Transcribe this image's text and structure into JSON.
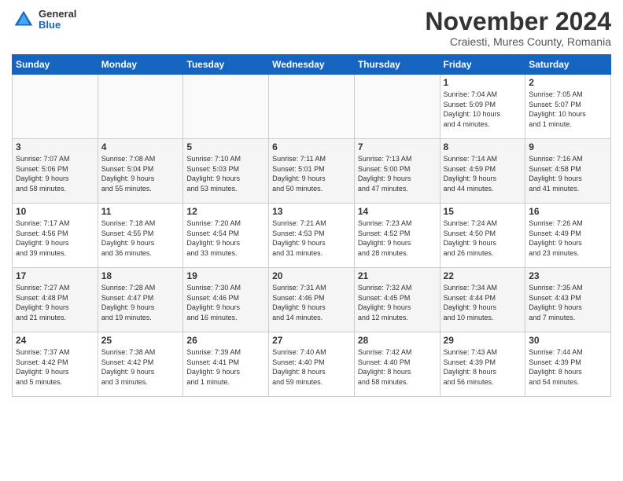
{
  "header": {
    "logo_general": "General",
    "logo_blue": "Blue",
    "month_title": "November 2024",
    "subtitle": "Craiesti, Mures County, Romania"
  },
  "weekdays": [
    "Sunday",
    "Monday",
    "Tuesday",
    "Wednesday",
    "Thursday",
    "Friday",
    "Saturday"
  ],
  "weeks": [
    [
      {
        "day": "",
        "info": ""
      },
      {
        "day": "",
        "info": ""
      },
      {
        "day": "",
        "info": ""
      },
      {
        "day": "",
        "info": ""
      },
      {
        "day": "",
        "info": ""
      },
      {
        "day": "1",
        "info": "Sunrise: 7:04 AM\nSunset: 5:09 PM\nDaylight: 10 hours\nand 4 minutes."
      },
      {
        "day": "2",
        "info": "Sunrise: 7:05 AM\nSunset: 5:07 PM\nDaylight: 10 hours\nand 1 minute."
      }
    ],
    [
      {
        "day": "3",
        "info": "Sunrise: 7:07 AM\nSunset: 5:06 PM\nDaylight: 9 hours\nand 58 minutes."
      },
      {
        "day": "4",
        "info": "Sunrise: 7:08 AM\nSunset: 5:04 PM\nDaylight: 9 hours\nand 55 minutes."
      },
      {
        "day": "5",
        "info": "Sunrise: 7:10 AM\nSunset: 5:03 PM\nDaylight: 9 hours\nand 53 minutes."
      },
      {
        "day": "6",
        "info": "Sunrise: 7:11 AM\nSunset: 5:01 PM\nDaylight: 9 hours\nand 50 minutes."
      },
      {
        "day": "7",
        "info": "Sunrise: 7:13 AM\nSunset: 5:00 PM\nDaylight: 9 hours\nand 47 minutes."
      },
      {
        "day": "8",
        "info": "Sunrise: 7:14 AM\nSunset: 4:59 PM\nDaylight: 9 hours\nand 44 minutes."
      },
      {
        "day": "9",
        "info": "Sunrise: 7:16 AM\nSunset: 4:58 PM\nDaylight: 9 hours\nand 41 minutes."
      }
    ],
    [
      {
        "day": "10",
        "info": "Sunrise: 7:17 AM\nSunset: 4:56 PM\nDaylight: 9 hours\nand 39 minutes."
      },
      {
        "day": "11",
        "info": "Sunrise: 7:18 AM\nSunset: 4:55 PM\nDaylight: 9 hours\nand 36 minutes."
      },
      {
        "day": "12",
        "info": "Sunrise: 7:20 AM\nSunset: 4:54 PM\nDaylight: 9 hours\nand 33 minutes."
      },
      {
        "day": "13",
        "info": "Sunrise: 7:21 AM\nSunset: 4:53 PM\nDaylight: 9 hours\nand 31 minutes."
      },
      {
        "day": "14",
        "info": "Sunrise: 7:23 AM\nSunset: 4:52 PM\nDaylight: 9 hours\nand 28 minutes."
      },
      {
        "day": "15",
        "info": "Sunrise: 7:24 AM\nSunset: 4:50 PM\nDaylight: 9 hours\nand 26 minutes."
      },
      {
        "day": "16",
        "info": "Sunrise: 7:26 AM\nSunset: 4:49 PM\nDaylight: 9 hours\nand 23 minutes."
      }
    ],
    [
      {
        "day": "17",
        "info": "Sunrise: 7:27 AM\nSunset: 4:48 PM\nDaylight: 9 hours\nand 21 minutes."
      },
      {
        "day": "18",
        "info": "Sunrise: 7:28 AM\nSunset: 4:47 PM\nDaylight: 9 hours\nand 19 minutes."
      },
      {
        "day": "19",
        "info": "Sunrise: 7:30 AM\nSunset: 4:46 PM\nDaylight: 9 hours\nand 16 minutes."
      },
      {
        "day": "20",
        "info": "Sunrise: 7:31 AM\nSunset: 4:46 PM\nDaylight: 9 hours\nand 14 minutes."
      },
      {
        "day": "21",
        "info": "Sunrise: 7:32 AM\nSunset: 4:45 PM\nDaylight: 9 hours\nand 12 minutes."
      },
      {
        "day": "22",
        "info": "Sunrise: 7:34 AM\nSunset: 4:44 PM\nDaylight: 9 hours\nand 10 minutes."
      },
      {
        "day": "23",
        "info": "Sunrise: 7:35 AM\nSunset: 4:43 PM\nDaylight: 9 hours\nand 7 minutes."
      }
    ],
    [
      {
        "day": "24",
        "info": "Sunrise: 7:37 AM\nSunset: 4:42 PM\nDaylight: 9 hours\nand 5 minutes."
      },
      {
        "day": "25",
        "info": "Sunrise: 7:38 AM\nSunset: 4:42 PM\nDaylight: 9 hours\nand 3 minutes."
      },
      {
        "day": "26",
        "info": "Sunrise: 7:39 AM\nSunset: 4:41 PM\nDaylight: 9 hours\nand 1 minute."
      },
      {
        "day": "27",
        "info": "Sunrise: 7:40 AM\nSunset: 4:40 PM\nDaylight: 8 hours\nand 59 minutes."
      },
      {
        "day": "28",
        "info": "Sunrise: 7:42 AM\nSunset: 4:40 PM\nDaylight: 8 hours\nand 58 minutes."
      },
      {
        "day": "29",
        "info": "Sunrise: 7:43 AM\nSunset: 4:39 PM\nDaylight: 8 hours\nand 56 minutes."
      },
      {
        "day": "30",
        "info": "Sunrise: 7:44 AM\nSunset: 4:39 PM\nDaylight: 8 hours\nand 54 minutes."
      }
    ]
  ]
}
